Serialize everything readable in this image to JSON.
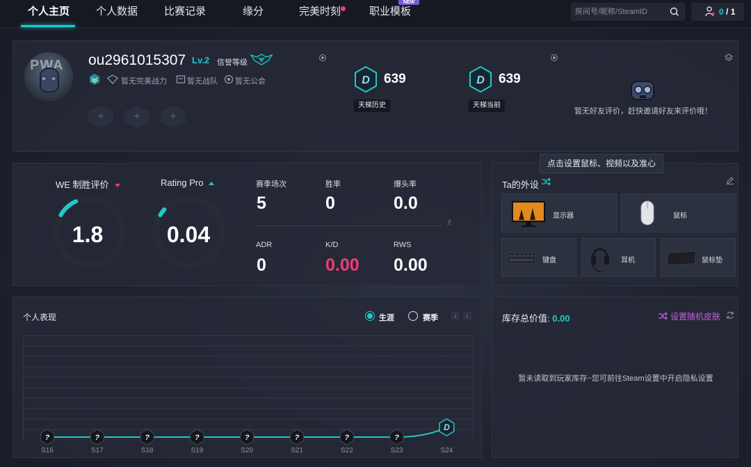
{
  "nav": {
    "tabs": [
      "个人主页",
      "个人数据",
      "比赛记录",
      "缘分",
      "完美时刻",
      "职业模板"
    ],
    "active_tab": "个人主页",
    "new_badge": "NEW",
    "search_placeholder": "房间号/昵称/SteamID",
    "notif_current": "0",
    "notif_total": "/ 1"
  },
  "profile": {
    "avatar_text": "PWA",
    "username": "ou2961015307",
    "level": "Lv.2",
    "credit_label": "信誉等级",
    "no_perfect": "暂无完美战力",
    "no_team": "暂无战队",
    "no_guild": "暂无公会",
    "plus": "+",
    "ladder_history_label": "天梯历史",
    "ladder_history_score": "639",
    "ladder_current_label": "天梯当前",
    "ladder_current_score": "639",
    "rank_letter": "D",
    "friend_eval_text": "暂无好友评价，赶快邀请好友来评价哦！",
    "tooltip": "点击设置鼠标、视频以及准心"
  },
  "stats": {
    "we_label": "WE 制胜评价",
    "we_value": "1.8",
    "we_level": 0.18,
    "rating_label": "Rating Pro",
    "rating_value": "0.04",
    "rating_level": 0.04,
    "season_matches_label": "赛季场次",
    "season_matches": "5",
    "winrate_label": "胜率",
    "winrate": "0",
    "headshot_label": "爆头率",
    "headshot": "0.0",
    "adr_label": "ADR",
    "adr": "0",
    "kd_label": "K/D",
    "kd": "0.00",
    "rws_label": "RWS",
    "rws": "0.00",
    "slashes": "////"
  },
  "gear": {
    "title": "Ta的外设",
    "monitor": "显示器",
    "mouse": "鼠标",
    "keyboard": "键盘",
    "headset": "耳机",
    "mousepad": "鼠标垫"
  },
  "perf": {
    "title": "个人表现",
    "option_career": "生涯",
    "option_season": "赛季",
    "prev": "‹",
    "next": "›",
    "unknown_rank": "?",
    "seasons": [
      "S16",
      "S17",
      "S18",
      "S19",
      "S20",
      "S21",
      "S22",
      "S23",
      "S24"
    ],
    "last_rank": "D"
  },
  "inventory": {
    "total_label": "库存总价值:",
    "total_value": "0.00",
    "random_skin": "设置随机皮肤",
    "empty_text": "暂未读取到玩家库存~您可前往Steam设置中开启隐私设置"
  },
  "colors": {
    "accent": "#22c9c9",
    "pink": "#ef3c73",
    "purple": "#c65fe0"
  }
}
